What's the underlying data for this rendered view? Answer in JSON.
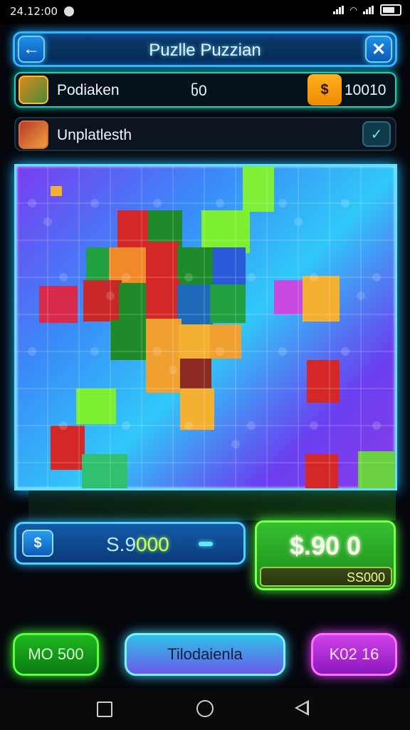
{
  "status_bar": {
    "time": "24.12:00",
    "wifi_icon": "wifi-icon",
    "battery_icon": "battery-icon"
  },
  "header": {
    "title": "Puzlle Puzzian",
    "back_icon": "arrow-left-icon",
    "close_icon": "close-icon"
  },
  "player_row": {
    "name": "Podiaken",
    "mid_value": "ნ0",
    "coin_symbol": "$",
    "coin_value": "10010"
  },
  "task_row": {
    "label": "Unplatlesth",
    "check_icon": "check-icon"
  },
  "score": {
    "left_icon_symbol": "$",
    "left_prefix": "S.9",
    "left_value": "000",
    "right_big": "$.90 0",
    "right_sub": "SS000"
  },
  "buttons": {
    "left": "MO 500",
    "center": "Tilodaienla",
    "right": "K02 16"
  },
  "colors": {
    "accent_cyan": "#2fb6ff",
    "accent_green": "#4aff30",
    "accent_pink": "#e040ff",
    "coin_orange": "#f59a10"
  }
}
